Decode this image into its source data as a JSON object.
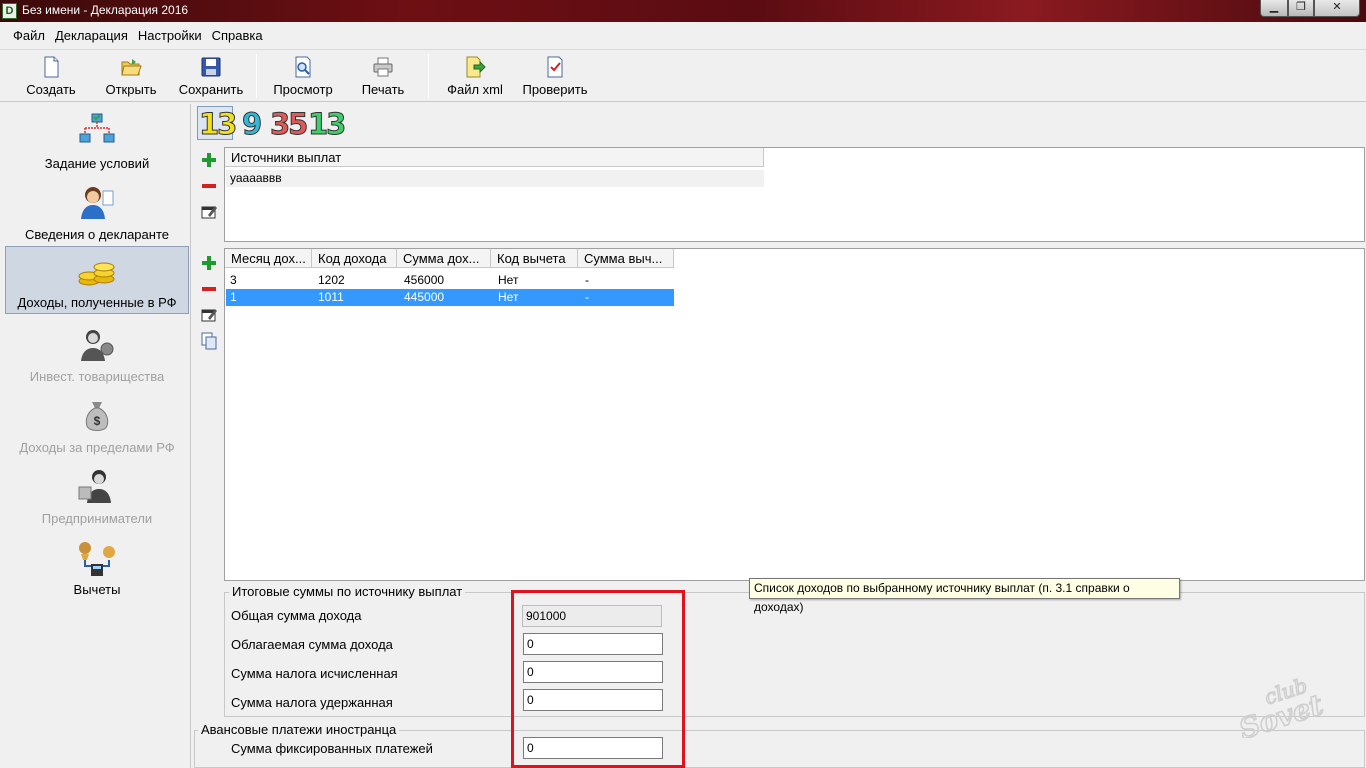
{
  "window": {
    "title": "Без имени - Декларация 2016",
    "app_icon_letter": "D"
  },
  "menu": [
    "Файл",
    "Декларация",
    "Настройки",
    "Справка"
  ],
  "toolbar": {
    "create": "Создать",
    "open": "Открыть",
    "save": "Сохранить",
    "preview": "Просмотр",
    "print": "Печать",
    "xml": "Файл xml",
    "check": "Проверить"
  },
  "nav": [
    {
      "label": "Задание условий",
      "icon": "flowchart-icon"
    },
    {
      "label": "Сведения о декларанте",
      "icon": "person-icon"
    },
    {
      "label": "Доходы, полученные в РФ",
      "icon": "coins-icon"
    },
    {
      "label": "Инвест. товарищества",
      "icon": "investor-icon"
    },
    {
      "label": "Доходы за пределами РФ",
      "icon": "money-bag-icon"
    },
    {
      "label": "Предприниматели",
      "icon": "entrepreneur-icon"
    },
    {
      "label": "Вычеты",
      "icon": "deductions-icon"
    }
  ],
  "rates": [
    "13",
    "9",
    "35",
    "13"
  ],
  "sources": {
    "header": "Источники выплат",
    "rows": [
      "уааааввв"
    ]
  },
  "incomes": {
    "columns": [
      "Месяц дох...",
      "Код дохода",
      "Сумма дох...",
      "Код вычета",
      "Сумма выч..."
    ],
    "rows": [
      [
        "3",
        "1202",
        "456000",
        "Нет",
        "-"
      ],
      [
        "1",
        "1011",
        "445000",
        "Нет",
        "-"
      ]
    ]
  },
  "tooltip": "Список доходов по выбранному источнику выплат (п. 3.1 справки о доходах)",
  "totals": {
    "title": "Итоговые суммы по источнику выплат",
    "total_income_label": "Общая сумма дохода",
    "total_income_value": "901000",
    "taxable_label": "Облагаемая сумма дохода",
    "taxable_value": "0",
    "tax_calc_label": "Сумма налога исчисленная",
    "tax_calc_value": "0",
    "tax_withheld_label": "Сумма налога удержанная",
    "tax_withheld_value": "0"
  },
  "advance": {
    "title": "Авансовые платежи иностранца",
    "fixed_label": "Сумма фиксированных платежей",
    "fixed_value": "0"
  },
  "colors": {
    "selection": "#3399ff",
    "highlight_box": "#e0121d",
    "rate1": "#f3e21a",
    "rate2": "#35b8d6",
    "rate3": "#e05a5a",
    "rate4": "#3ccf6a"
  }
}
